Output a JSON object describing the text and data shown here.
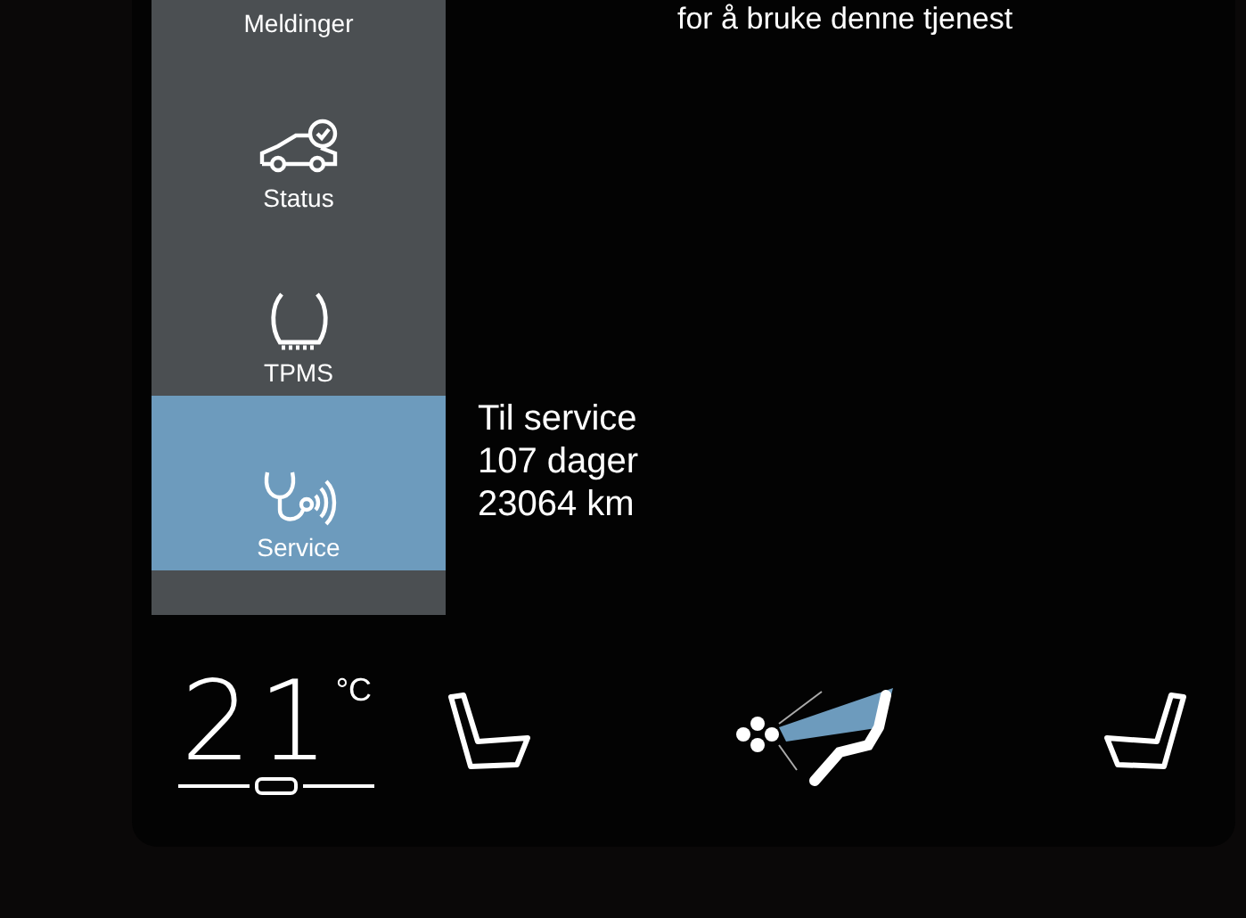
{
  "header": {
    "text": "for å bruke denne tjenest"
  },
  "sidebar": {
    "items": [
      {
        "label": "Meldinger",
        "kind": "label",
        "selected": false
      },
      {
        "label": "Status",
        "kind": "status",
        "selected": false
      },
      {
        "label": "TPMS",
        "kind": "tpms",
        "selected": false
      },
      {
        "label": "Service",
        "kind": "service",
        "selected": true
      }
    ]
  },
  "service_info": {
    "lines": [
      "Til service",
      "107 dager",
      "23064 km"
    ]
  },
  "climate": {
    "temperature": "21",
    "unit": "°C"
  }
}
